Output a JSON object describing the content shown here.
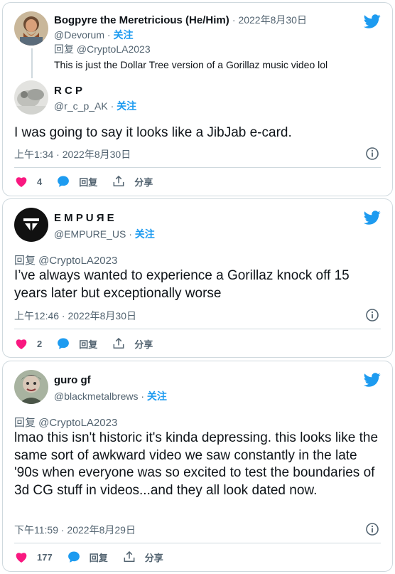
{
  "colors": {
    "accent": "#1d9bf0",
    "like": "#f91880",
    "muted": "#536471",
    "border": "#cfd9de"
  },
  "tweets": [
    {
      "parent": {
        "name": "Bogpyre the Meretricious (He/Him)",
        "date": "· 2022年8月30日",
        "handle": "@Devorum ·",
        "follow": "关注",
        "reply_to": "回复 @CryptoLA2023",
        "text": "This is just the Dollar Tree version of a Gorillaz music video lol"
      },
      "name": "R C P",
      "handle": "@r_c_p_AK ·",
      "follow": "关注",
      "text": "I was going to say it looks like a JibJab e-card.",
      "timestamp": "上午1:34 · 2022年8月30日",
      "likes": "4",
      "reply_label": "回复",
      "share_label": "分享"
    },
    {
      "name": "E M P U Я E",
      "handle": "@EMPURE_US ·",
      "follow": "关注",
      "reply_to": "回复 @CryptoLA2023",
      "text": "I’ve always wanted to experience a Gorillaz knock off 15 years later but exceptionally worse",
      "timestamp": "上午12:46 · 2022年8月30日",
      "likes": "2",
      "reply_label": "回复",
      "share_label": "分享"
    },
    {
      "name": "guro gf",
      "handle": "@blackmetalbrews ·",
      "follow": "关注",
      "reply_to": "回复 @CryptoLA2023",
      "text": "lmao this isn't historic it's kinda depressing. this looks like the same sort of awkward video we saw constantly in the late '90s when everyone was so excited to test the boundaries of 3d CG stuff in videos...and they all look dated now.",
      "timestamp": "下午11:59 · 2022年8月29日",
      "likes": "177",
      "reply_label": "回复",
      "share_label": "分享"
    }
  ],
  "icons": [
    "twitter-bird-icon",
    "heart-icon",
    "reply-bubble-icon",
    "share-icon",
    "info-icon"
  ]
}
